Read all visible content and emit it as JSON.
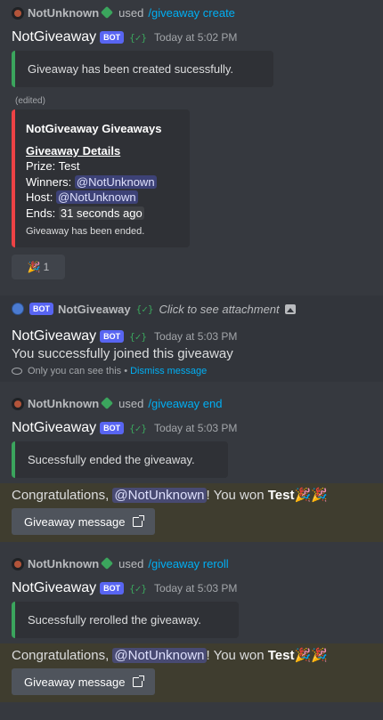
{
  "messages": {
    "m1": {
      "reply_user": "NotUnknown",
      "used": "used",
      "command": "/giveaway create",
      "author": "NotGiveaway",
      "bot_tag": "BOT",
      "verified": "{✓}",
      "time": "Today at 5:02 PM",
      "content": "Giveaway has been created sucessfully.",
      "edited": "(edited)",
      "embed": {
        "title": "NotGiveaway Giveaways",
        "field_title": "Giveaway Details",
        "prize": "Prize: Test",
        "winners_label": "Winners:",
        "winners": "@NotUnknown",
        "host_label": "Host:",
        "host": "@NotUnknown",
        "ends_label": "Ends:",
        "ends": "31 seconds ago",
        "footer": "Giveaway has been ended."
      },
      "reaction_emoji": "🎉",
      "reaction_count": "1"
    },
    "m2": {
      "bot_tag": "BOT",
      "bot_name": "NotGiveaway",
      "verified": "{✓}",
      "attachment": "Click to see attachment",
      "author": "NotGiveaway",
      "time": "Today at 5:03 PM",
      "content": "You successfully joined this giveaway",
      "note": "Only you can see this •",
      "dismiss": "Dismiss message"
    },
    "m3": {
      "reply_user": "NotUnknown",
      "used": "used",
      "command": "/giveaway end",
      "author": "NotGiveaway",
      "bot_tag": "BOT",
      "verified": "{✓}",
      "time": "Today at 5:03 PM",
      "content": "Sucessfully ended the giveaway.",
      "congrats_prefix": "Congratulations,",
      "mention": "@NotUnknown",
      "congrats_mid": "! You won",
      "prize": "Test",
      "emoji": "🎉🎉",
      "button": "Giveaway message"
    },
    "m4": {
      "reply_user": "NotUnknown",
      "used": "used",
      "command": "/giveaway reroll",
      "author": "NotGiveaway",
      "bot_tag": "BOT",
      "verified": "{✓}",
      "time": "Today at 5:03 PM",
      "content": "Sucessfully rerolled the giveaway.",
      "congrats_prefix": "Congratulations,",
      "mention": "@NotUnknown",
      "congrats_mid": "! You won",
      "prize": "Test",
      "emoji": "🎉🎉",
      "button": "Giveaway message"
    }
  }
}
